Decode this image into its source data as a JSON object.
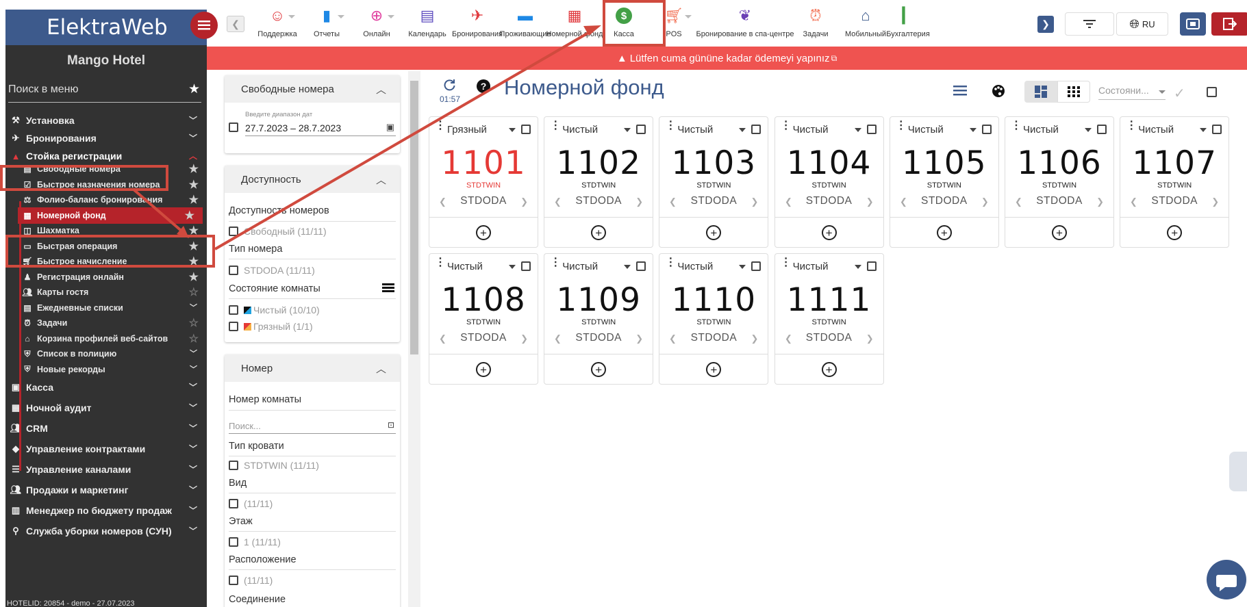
{
  "app": {
    "logo": "ElektraWeb",
    "hotel_name": "Mango Hotel",
    "hotel_id": "HOTELID: 20854 - demo - 27.07.2023"
  },
  "colors": {
    "brand": "#3d5a8c",
    "accent_red": "#b5232a",
    "warning_bg": "#ef5350",
    "highlight": "#d04a3e",
    "dirty": "#e53935"
  },
  "modules": [
    {
      "label": "Поддержка",
      "icon": "support-icon",
      "color": "#e0393e",
      "dropdown": true
    },
    {
      "label": "Отчеты",
      "icon": "bar-chart-icon",
      "color": "#1e88e5",
      "dropdown": true
    },
    {
      "label": "Онлайн",
      "icon": "globe-icon",
      "color": "#e040a0",
      "dropdown": true
    },
    {
      "label": "Календарь",
      "icon": "calendar-icon",
      "color": "#5c4bbf",
      "dropdown": false
    },
    {
      "label": "Бронирования",
      "icon": "plane-landing-icon",
      "color": "#e0393e",
      "dropdown": false
    },
    {
      "label": "Проживающие",
      "icon": "bed-icon",
      "color": "#1e88e5",
      "dropdown": false
    },
    {
      "label": "Номерной фонд",
      "icon": "room-grid-icon",
      "color": "#e0393e",
      "dropdown": false
    },
    {
      "label": "Касса",
      "icon": "dollar-icon",
      "color": "#43a047",
      "dropdown": false
    },
    {
      "label": "POS",
      "icon": "cart-icon",
      "color": "#f26d50",
      "dropdown": true
    },
    {
      "label": "Бронирование в спа-центре",
      "icon": "spa-icon",
      "color": "#6a3fb5",
      "dropdown": false
    },
    {
      "label": "Задачи",
      "icon": "alarm-icon",
      "color": "#f26d50",
      "dropdown": false
    },
    {
      "label": "Мобильный",
      "icon": "home-icon",
      "color": "#3d5a8c",
      "dropdown": false
    },
    {
      "label": "Бухгалтерия",
      "icon": "accounting-icon",
      "color": "#43a047",
      "dropdown": false
    }
  ],
  "top_right": {
    "lang": "RU"
  },
  "warning": {
    "text": "Lütfen cuma gününe kadar ödemeyi yapınız"
  },
  "sidebar": {
    "search_placeholder": "Поиск в меню",
    "groups": [
      {
        "label": "Установка",
        "icon": "tools-icon"
      },
      {
        "label": "Бронирования",
        "icon": "plane-icon"
      },
      {
        "label": "Стойка регистрации",
        "icon": "reception-icon",
        "expanded": true
      }
    ],
    "subitems": [
      {
        "label": "Свободные номера",
        "icon": "doc-icon",
        "star": "filled"
      },
      {
        "label": "Быстрое назначения номера",
        "icon": "check-square-icon",
        "star": "filled"
      },
      {
        "label": "Фолио-баланс бронирования",
        "icon": "scale-icon",
        "star": "filled"
      },
      {
        "label": "Номерной фонд",
        "icon": "grid-icon",
        "star": "filled",
        "active": true
      },
      {
        "label": "Шахматка",
        "icon": "board-icon",
        "star": "filled"
      },
      {
        "label": "Быстрая операция",
        "icon": "laptop-icon",
        "star": "filled"
      },
      {
        "label": "Быстрое начисление",
        "icon": "cart-icon",
        "star": "filled"
      },
      {
        "label": "Регистрация онлайн",
        "icon": "person-icon",
        "star": "filled"
      },
      {
        "label": "Карты гостя",
        "icon": "people-icon",
        "star": "outline"
      },
      {
        "label": "Ежедневные списки",
        "icon": "doc-icon",
        "chevron": true
      },
      {
        "label": "Задачи",
        "icon": "alarm-icon",
        "star": "outline"
      },
      {
        "label": "Корзина профилей веб-сайтов",
        "icon": "basket-icon",
        "star": "outline"
      },
      {
        "label": "Список в полицию",
        "icon": "shield-icon",
        "chevron": true
      },
      {
        "label": "Новые рекорды",
        "icon": "shield-icon",
        "chevron": true
      }
    ],
    "groups_after": [
      {
        "label": "Касса",
        "icon": "cash-icon"
      },
      {
        "label": "Ночной аудит",
        "icon": "calendar-icon"
      },
      {
        "label": "CRM",
        "icon": "people-icon"
      },
      {
        "label": "Управление контрактами",
        "icon": "tag-icon"
      },
      {
        "label": "Управление каналами",
        "icon": "list-icon"
      },
      {
        "label": "Продажи и маркетинг",
        "icon": "people-icon"
      },
      {
        "label": "Менеджер по бюджету продаж",
        "icon": "chart-icon"
      },
      {
        "label": "Служба уборки номеров (СУН)",
        "icon": "cleaner-icon"
      }
    ]
  },
  "filters": {
    "free_rooms": {
      "title": "Свободные номера",
      "date_label": "Введите диапазон дат",
      "date_value": "27.7.2023 – 28.7.2023"
    },
    "availability": {
      "title": "Доступность",
      "availability_label": "Доступность номеров",
      "free_option": "Свободный (11/11)",
      "room_type_label": "Тип номера",
      "room_type_option": "STDODA (11/11)",
      "state_label": "Состояние комнаты",
      "clean_option": "Чистый (10/10)",
      "dirty_option": "Грязный (1/1)"
    },
    "number": {
      "title": "Номер",
      "room_number_label": "Номер комнаты",
      "search_placeholder": "Поиск...",
      "bed_type_label": "Тип кровати",
      "bed_type_option": "STDTWIN (11/11)",
      "view_label": "Вид",
      "view_option": "(11/11)",
      "floor_label": "Этаж",
      "floor_option": "1 (11/11)",
      "location_label": "Расположение",
      "location_option": "(11/11)",
      "connection_label": "Соединение"
    }
  },
  "main": {
    "time": "01:57",
    "title": "Номерной фонд",
    "state_select": "Состояни..."
  },
  "rooms": [
    {
      "number": "1101",
      "status": "Грязный",
      "bed": "STDTWIN",
      "type": "STDODA",
      "dirty": true
    },
    {
      "number": "1102",
      "status": "Чистый",
      "bed": "STDTWIN",
      "type": "STDODA",
      "dirty": false
    },
    {
      "number": "1103",
      "status": "Чистый",
      "bed": "STDTWIN",
      "type": "STDODA",
      "dirty": false
    },
    {
      "number": "1104",
      "status": "Чистый",
      "bed": "STDTWIN",
      "type": "STDODA",
      "dirty": false
    },
    {
      "number": "1105",
      "status": "Чистый",
      "bed": "STDTWIN",
      "type": "STDODA",
      "dirty": false
    },
    {
      "number": "1106",
      "status": "Чистый",
      "bed": "STDTWIN",
      "type": "STDODA",
      "dirty": false
    },
    {
      "number": "1107",
      "status": "Чистый",
      "bed": "STDTWIN",
      "type": "STDODA",
      "dirty": false
    },
    {
      "number": "1108",
      "status": "Чистый",
      "bed": "STDTWIN",
      "type": "STDODA",
      "dirty": false
    },
    {
      "number": "1109",
      "status": "Чистый",
      "bed": "STDTWIN",
      "type": "STDODA",
      "dirty": false
    },
    {
      "number": "1110",
      "status": "Чистый",
      "bed": "STDTWIN",
      "type": "STDODA",
      "dirty": false
    },
    {
      "number": "1111",
      "status": "Чистый",
      "bed": "STDTWIN",
      "type": "STDODA",
      "dirty": false
    }
  ]
}
